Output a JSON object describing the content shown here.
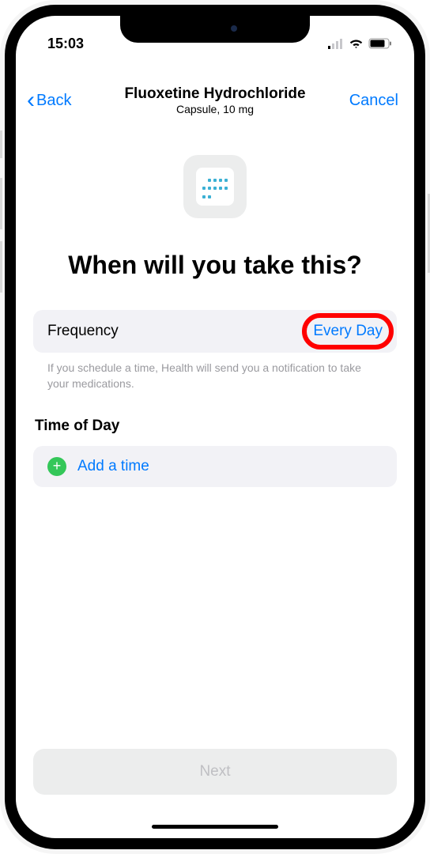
{
  "statusBar": {
    "time": "15:03"
  },
  "nav": {
    "back": "Back",
    "title": "Fluoxetine Hydrochloride",
    "subtitle": "Capsule, 10 mg",
    "cancel": "Cancel"
  },
  "heading": "When will you take this?",
  "frequency": {
    "label": "Frequency",
    "value": "Every Day"
  },
  "hint": "If you schedule a time, Health will send you a notification to take your medications.",
  "timeOfDay": {
    "header": "Time of Day",
    "addLabel": "Add a time"
  },
  "nextButton": "Next"
}
